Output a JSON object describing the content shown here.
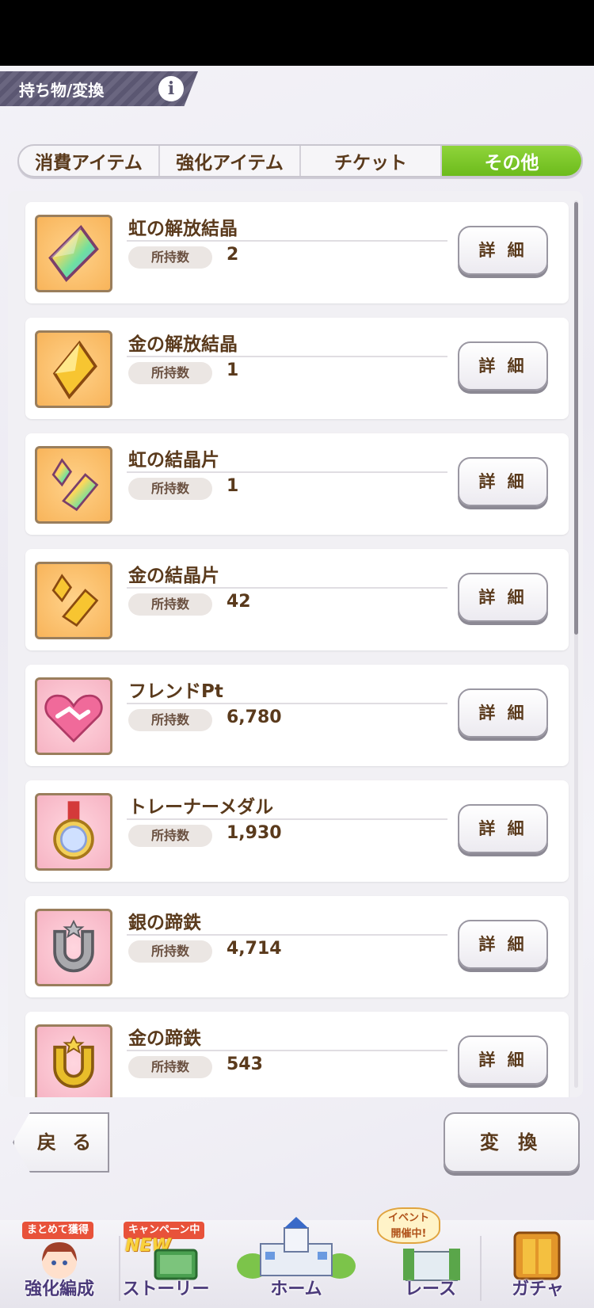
{
  "header": {
    "title": "持ち物/変換",
    "info_icon": "i"
  },
  "tabs": [
    {
      "label": "消費アイテム",
      "active": false
    },
    {
      "label": "強化アイテム",
      "active": false
    },
    {
      "label": "チケット",
      "active": false
    },
    {
      "label": "その他",
      "active": true
    }
  ],
  "owned_label": "所持数",
  "detail_label": "詳 細",
  "items": [
    {
      "name": "虹の解放結晶",
      "count": "2",
      "icon": "rainbow-crystal-icon"
    },
    {
      "name": "金の解放結晶",
      "count": "1",
      "icon": "gold-crystal-icon"
    },
    {
      "name": "虹の結晶片",
      "count": "1",
      "icon": "rainbow-shard-icon"
    },
    {
      "name": "金の結晶片",
      "count": "42",
      "icon": "gold-shard-icon"
    },
    {
      "name": "フレンドPt",
      "count": "6,780",
      "icon": "handshake-icon"
    },
    {
      "name": "トレーナーメダル",
      "count": "1,930",
      "icon": "medal-icon"
    },
    {
      "name": "銀の蹄鉄",
      "count": "4,714",
      "icon": "silver-horseshoe-icon"
    },
    {
      "name": "金の蹄鉄",
      "count": "543",
      "icon": "gold-horseshoe-icon"
    }
  ],
  "actions": {
    "back": "戻 る",
    "convert": "変 換"
  },
  "bottom_nav": [
    {
      "label": "強化編成",
      "badge": "まとめて獲得"
    },
    {
      "label": "ストーリー",
      "badge": "キャンペーン中",
      "new": "NEW"
    },
    {
      "label": "ホーム"
    },
    {
      "label": "レース",
      "event_badge_line1": "イベント",
      "event_badge_line2": "開催中!"
    },
    {
      "label": "ガチャ"
    }
  ],
  "colors": {
    "active_tab": "#7cc42a",
    "text_brown": "#5a3a1c",
    "nav_text": "#4b3a7a"
  }
}
